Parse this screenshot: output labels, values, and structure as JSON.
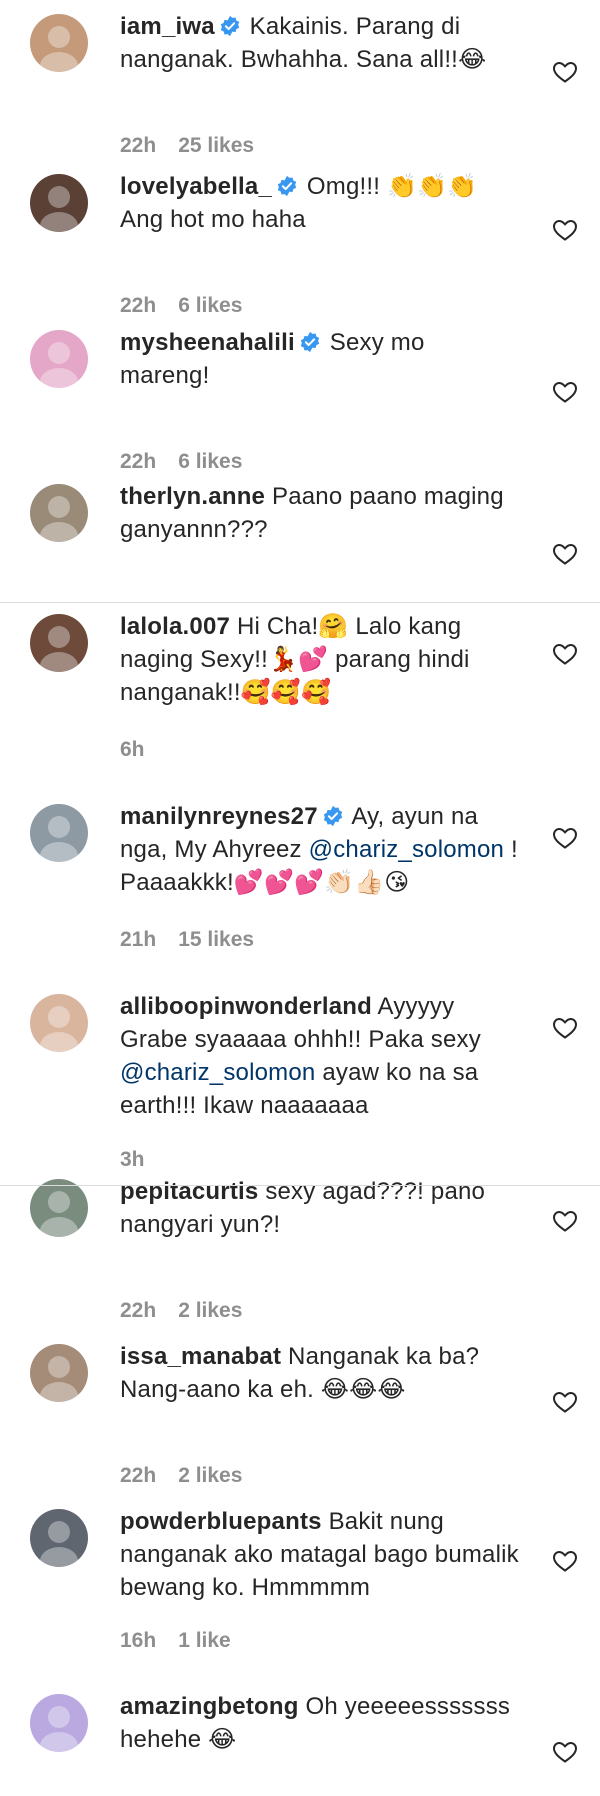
{
  "comments": [
    {
      "username": "iam_iwa",
      "verified": true,
      "text": [
        "Kakainis. Parang di nanganak. Bwhahha. Sana all!!",
        {
          "emoji": "😂"
        }
      ],
      "time": "22h",
      "likes": "25 likes",
      "avatar_color": "#c49a7a"
    },
    {
      "username": "lovelyabella_",
      "verified": true,
      "text": [
        "Omg!!! ",
        {
          "emoji": "👏👏👏"
        },
        " Ang hot mo haha"
      ],
      "time": "22h",
      "likes": "6 likes",
      "avatar_color": "#5a4035"
    },
    {
      "username": "mysheenahalili",
      "verified": true,
      "text": [
        "Sexy mo mareng!"
      ],
      "time": "22h",
      "likes": "6 likes",
      "avatar_color": "#e4a7c8"
    },
    {
      "username": "therlyn.anne",
      "verified": false,
      "text": [
        "Paano paano maging ganyannn???"
      ],
      "time": "",
      "likes": "",
      "avatar_color": "#9a8a78"
    },
    {
      "username": "lalola.007",
      "verified": false,
      "text": [
        "Hi Cha!",
        {
          "emoji": "🤗"
        },
        " Lalo kang naging Sexy!!",
        {
          "emoji": "💃💕"
        },
        " parang hindi nanganak!!",
        {
          "emoji": "🥰🥰🥰"
        }
      ],
      "time": "6h",
      "likes": "",
      "avatar_color": "#6d4a3a"
    },
    {
      "username": "manilynreynes27",
      "verified": true,
      "text": [
        "Ay, ayun na nga, My Ahyreez ",
        {
          "mention": "@chariz_solomon"
        },
        " ! Paaaakkk!",
        {
          "emoji": "💕💕💕👏🏻👍🏻😘"
        }
      ],
      "time": "21h",
      "likes": "15 likes",
      "avatar_color": "#8d9aa3"
    },
    {
      "username": "alliboopinwonderland",
      "verified": false,
      "text": [
        "Ayyyyy Grabe syaaaaa ohhh!! Paka sexy ",
        {
          "mention": "@chariz_solomon"
        },
        " ayaw ko na sa earth!!! Ikaw naaaaaaa"
      ],
      "time": "3h",
      "likes": "",
      "avatar_color": "#d9b59e"
    },
    {
      "username": "pepitacurtis",
      "verified": false,
      "text": [
        "sexy agad???! pano nangyari yun?!"
      ],
      "time": "22h",
      "likes": "2 likes",
      "avatar_color": "#7a8c7e"
    },
    {
      "username": "issa_manabat",
      "verified": false,
      "text": [
        "Nanganak ka ba? Nang-aano ka eh. ",
        {
          "emoji": "😂😂😂"
        }
      ],
      "time": "22h",
      "likes": "2 likes",
      "avatar_color": "#a58c78"
    },
    {
      "username": "powderbluepants",
      "verified": false,
      "text": [
        "Bakit nung nanganak ako matagal bago bumalik bewang ko. Hmmmmm"
      ],
      "time": "16h",
      "likes": "1 like",
      "avatar_color": "#5f6670"
    },
    {
      "username": "amazingbetong",
      "verified": false,
      "text": [
        "Oh yeeeeesssssss hehehe ",
        {
          "emoji": "😂"
        }
      ],
      "time": "",
      "likes": "",
      "avatar_color": "#b9a9e0"
    }
  ],
  "colors": {
    "verified_badge": "#3897f0",
    "meta_text": "#8e8e8e",
    "mention": "#003569",
    "divider": "#dbdbdb"
  },
  "icons": {
    "like": "heart-outline-icon",
    "verified": "verified-badge-icon"
  }
}
